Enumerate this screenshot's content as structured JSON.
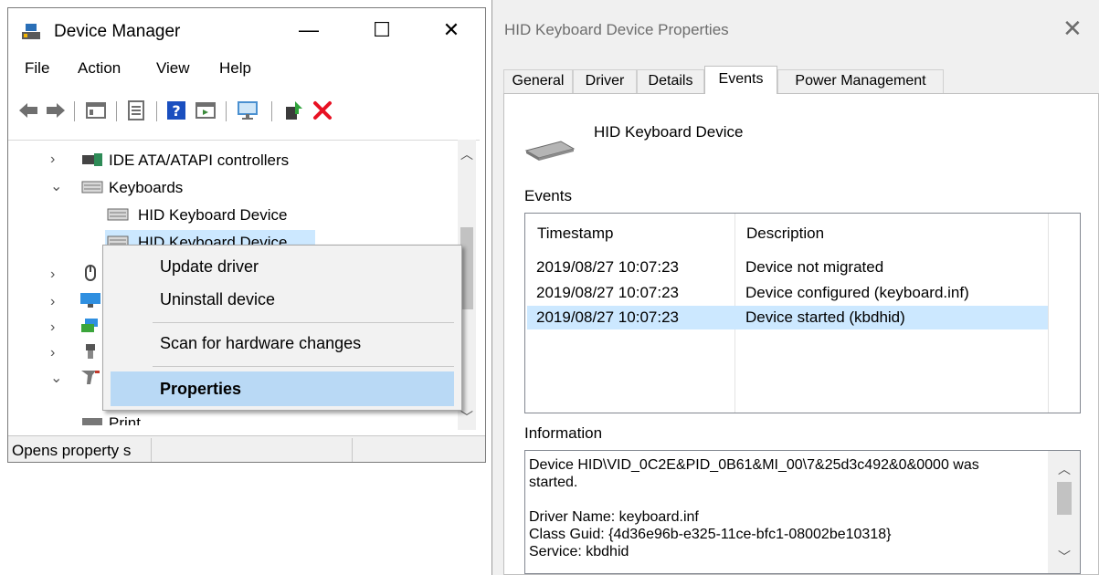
{
  "device_manager": {
    "title": "Device Manager",
    "menu": [
      "File",
      "Action",
      "View",
      "Help"
    ],
    "tree": {
      "ide": "IDE ATA/ATAPI controllers",
      "keyboards": "Keyboards",
      "hid1": "HID Keyboard Device",
      "hid2": "HID Keyboard Device",
      "printers_partial": "Print"
    },
    "status_text": "Opens property s",
    "context_menu": {
      "update_driver": "Update driver",
      "uninstall_device": "Uninstall device",
      "scan": "Scan for hardware changes",
      "properties": "Properties"
    },
    "window_controls": {
      "minimize": "—",
      "maximize": "☐",
      "close": "✕"
    }
  },
  "properties_dialog": {
    "title": "HID Keyboard Device Properties",
    "close": "✕",
    "tabs": [
      "General",
      "Driver",
      "Details",
      "Events",
      "Power Management"
    ],
    "active_tab": "Events",
    "device_name": "HID Keyboard Device",
    "events_label": "Events",
    "columns": [
      "Timestamp",
      "Description"
    ],
    "events": [
      {
        "timestamp": "2019/08/27 10:07:23",
        "description": "Device not migrated"
      },
      {
        "timestamp": "2019/08/27 10:07:23",
        "description": "Device configured (keyboard.inf)"
      },
      {
        "timestamp": "2019/08/27 10:07:23",
        "description": "Device started (kbdhid)"
      }
    ],
    "selected_event": 2,
    "information_label": "Information",
    "information_lines": [
      "Device HID\\VID_0C2E&PID_0B61&MI_00\\7&25d3c492&0&0000 was",
      "started.",
      "",
      "Driver Name: keyboard.inf",
      "Class Guid: {4d36e96b-e325-11ce-bfc1-08002be10318}",
      "Service: kbdhid"
    ]
  },
  "colors": {
    "selection": "#cce8ff",
    "menu_highlight": "#b9d9f5",
    "delete_red": "#e81123"
  }
}
